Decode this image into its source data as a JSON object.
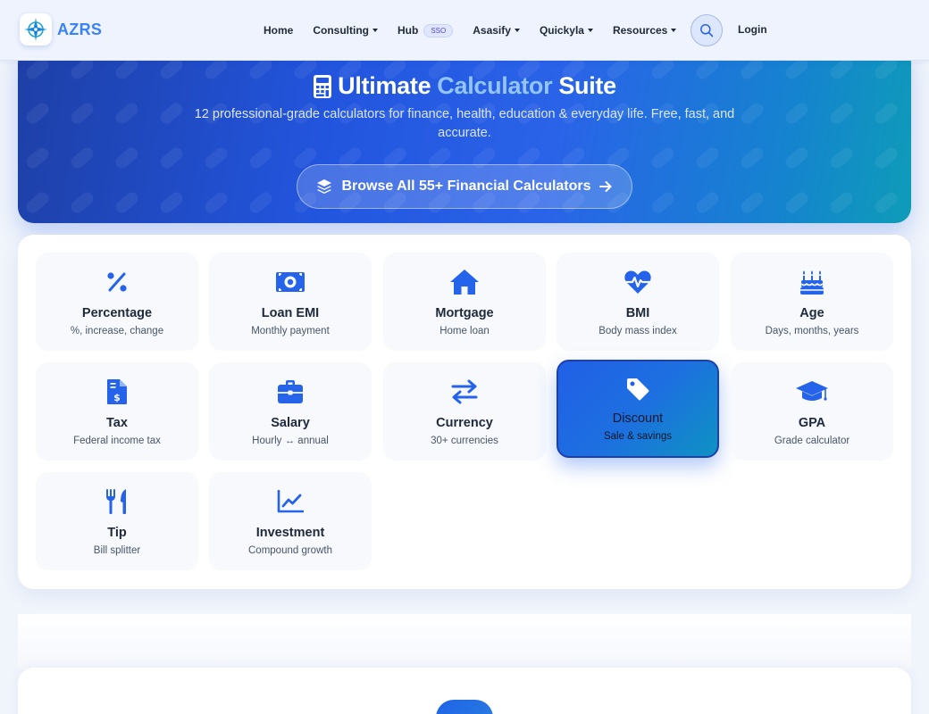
{
  "nav": {
    "brand": "AZRS",
    "items": [
      {
        "label": "Home",
        "dropdown": false
      },
      {
        "label": "Consulting",
        "dropdown": true
      },
      {
        "label": "Hub",
        "dropdown": false,
        "badge": "SSO"
      },
      {
        "label": "Asasify",
        "dropdown": true
      },
      {
        "label": "Quickyla",
        "dropdown": true
      },
      {
        "label": "Resources",
        "dropdown": true
      }
    ],
    "login": "Login"
  },
  "hero": {
    "title_pre": "Ultimate",
    "title_accent": "Calculator",
    "title_post": "Suite",
    "subtitle": "12 professional-grade calculators for finance, health, education & everyday life. Free, fast, and accurate.",
    "button_label": "Browse All 55+ Financial Calculators"
  },
  "calculators": [
    {
      "icon": "percent-icon",
      "title": "Percentage",
      "subtitle": "%, increase, change",
      "active": false
    },
    {
      "icon": "money-bill-icon",
      "title": "Loan EMI",
      "subtitle": "Monthly payment",
      "active": false
    },
    {
      "icon": "home-icon",
      "title": "Mortgage",
      "subtitle": "Home loan",
      "active": false
    },
    {
      "icon": "heart-pulse-icon",
      "title": "BMI",
      "subtitle": "Body mass index",
      "active": false
    },
    {
      "icon": "birthday-cake-icon",
      "title": "Age",
      "subtitle": "Days, months, years",
      "active": false
    },
    {
      "icon": "file-invoice-dollar-icon",
      "title": "Tax",
      "subtitle": "Federal income tax",
      "active": false
    },
    {
      "icon": "briefcase-icon",
      "title": "Salary",
      "subtitle": "Hourly ↔ annual",
      "active": false
    },
    {
      "icon": "exchange-icon",
      "title": "Currency",
      "subtitle": "30+ currencies",
      "active": false
    },
    {
      "icon": "tag-icon",
      "title": "Discount",
      "subtitle": "Sale & savings",
      "active": true
    },
    {
      "icon": "graduation-cap-icon",
      "title": "GPA",
      "subtitle": "Grade calculator",
      "active": false
    },
    {
      "icon": "utensils-icon",
      "title": "Tip",
      "subtitle": "Bill splitter",
      "active": false
    },
    {
      "icon": "chart-line-icon",
      "title": "Investment",
      "subtitle": "Compound growth",
      "active": false
    }
  ],
  "colors": {
    "accent": "#2563eb",
    "brand": "#3b82f6",
    "hero_accent_text": "#93c5fd",
    "active_card": "#1d6fe0"
  }
}
